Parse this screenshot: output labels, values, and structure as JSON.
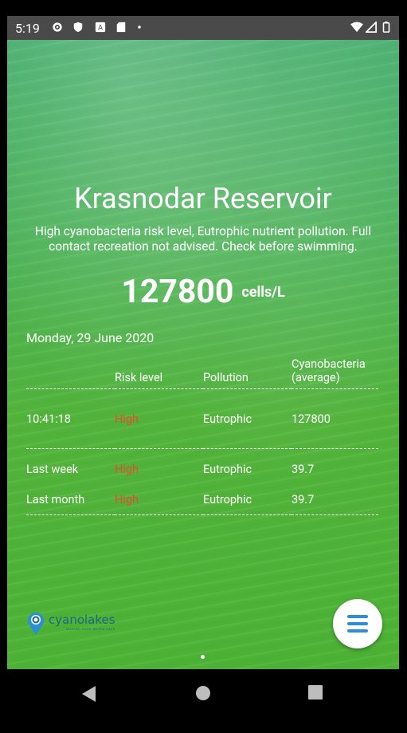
{
  "status_bar": {
    "time": "5:19",
    "icons": [
      "gear-icon",
      "shield-icon",
      "a-icon",
      "sd-card-icon",
      "dot-icon",
      "wifi-icon",
      "signal-icon",
      "battery-icon"
    ]
  },
  "lake": {
    "title": "Krasnodar Reservoir",
    "summary": "High cyanobacteria risk level, Eutrophic nutrient pollution. Full contact recreation not advised. Check before swimming.",
    "value": "127800",
    "unit": "cells/L",
    "date": "Monday, 29 June 2020"
  },
  "table": {
    "headers": [
      "",
      "Risk level",
      "Pollution",
      "Cyanobacteria (average)"
    ],
    "rows": [
      {
        "label": "10:41:18",
        "risk": "High",
        "pollution": "Eutrophic",
        "cyano": "127800"
      },
      {
        "label": "Last week",
        "risk": "High",
        "pollution": "Eutrophic",
        "cyano": "39.7"
      },
      {
        "label": "Last month",
        "risk": "High",
        "pollution": "Eutrophic",
        "cyano": "39.7"
      }
    ]
  },
  "logo": {
    "name": "cyanolakes",
    "tagline": "MAKING YOUR WATER SAFE"
  },
  "colors": {
    "risk_high": "#e84b2c",
    "fab_icon": "#2a8fd8",
    "logo_blue": "#1f6680"
  }
}
